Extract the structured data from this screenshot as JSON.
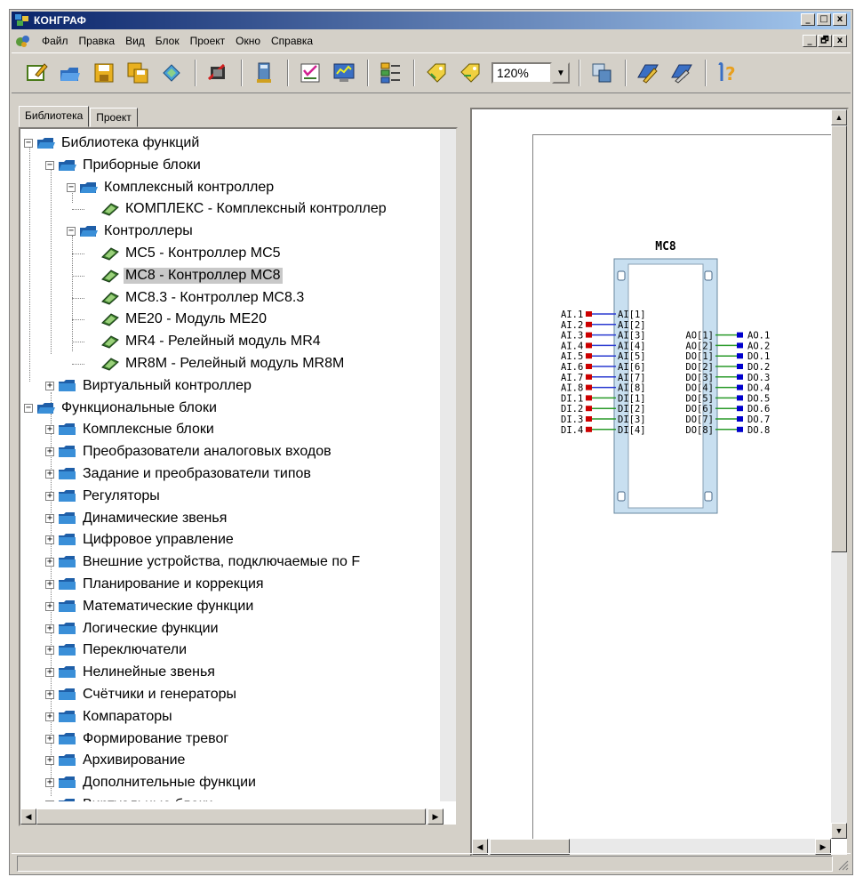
{
  "window": {
    "title": "КОНГРАФ"
  },
  "menu": [
    "Файл",
    "Правка",
    "Вид",
    "Блок",
    "Проект",
    "Окно",
    "Справка"
  ],
  "window_controls": [
    "_",
    "□",
    "x"
  ],
  "mdi_controls": [
    "_",
    "🗗",
    "x"
  ],
  "toolbar": {
    "zoom_value": "120%",
    "icons": [
      "new-icon",
      "open-icon",
      "save-icon",
      "save-all-icon",
      "refresh-icon",
      "compile-icon",
      "upload-icon",
      "checklist-icon",
      "monitor-icon",
      "block-list-icon",
      "tag-icon",
      "untag-icon",
      "copy-icon",
      "edit-icon",
      "pencil-icon",
      "help-icon"
    ]
  },
  "tabs": [
    "Библиотека",
    "Проект"
  ],
  "tree": [
    {
      "label": "Библиотека функций"
    },
    {
      "label": "Приборные блоки"
    },
    {
      "label": "Комплексный контроллер"
    },
    {
      "label": "КОМПЛЕКС - Комплексный контроллер"
    },
    {
      "label": "Контроллеры"
    },
    {
      "label": "MC5 - Контроллер MC5"
    },
    {
      "label": "MC8 - Контроллер MC8"
    },
    {
      "label": "MC8.3 - Контроллер MC8.3"
    },
    {
      "label": "ME20 - Модуль ME20"
    },
    {
      "label": "MR4 - Релейный модуль MR4"
    },
    {
      "label": "MR8M - Релейный модуль MR8M"
    },
    {
      "label": "Виртуальный контроллер"
    },
    {
      "label": "Функциональные блоки"
    },
    {
      "label": "Комплексные блоки"
    },
    {
      "label": "Преобразователи аналоговых входов"
    },
    {
      "label": "Задание и преобразователи типов"
    },
    {
      "label": "Регуляторы"
    },
    {
      "label": "Динамические звенья"
    },
    {
      "label": "Цифровое управление"
    },
    {
      "label": "Внешние устройства, подключаемые по F"
    },
    {
      "label": "Планирование и коррекция"
    },
    {
      "label": "Математические функции"
    },
    {
      "label": "Логические функции"
    },
    {
      "label": "Переключатели"
    },
    {
      "label": "Нелинейные звенья"
    },
    {
      "label": "Счётчики и генераторы"
    },
    {
      "label": "Компараторы"
    },
    {
      "label": "Формирование тревог"
    },
    {
      "label": "Архивирование"
    },
    {
      "label": "Дополнительные функции"
    },
    {
      "label": "Виртуальные блоки"
    }
  ],
  "block": {
    "name": "MC8",
    "inputs": [
      {
        "ext": "AI.1",
        "pin": "AI[1]"
      },
      {
        "ext": "AI.2",
        "pin": "AI[2]"
      },
      {
        "ext": "AI.3",
        "pin": "AI[3]"
      },
      {
        "ext": "AI.4",
        "pin": "AI[4]"
      },
      {
        "ext": "AI.5",
        "pin": "AI[5]"
      },
      {
        "ext": "AI.6",
        "pin": "AI[6]"
      },
      {
        "ext": "AI.7",
        "pin": "AI[7]"
      },
      {
        "ext": "AI.8",
        "pin": "AI[8]"
      },
      {
        "ext": "DI.1",
        "pin": "DI[1]"
      },
      {
        "ext": "DI.2",
        "pin": "DI[2]"
      },
      {
        "ext": "DI.3",
        "pin": "DI[3]"
      },
      {
        "ext": "DI.4",
        "pin": "DI[4]"
      }
    ],
    "outputs": [
      {
        "pin": "AO[1]",
        "ext": "AO.1"
      },
      {
        "pin": "AO[2]",
        "ext": "AO.2"
      },
      {
        "pin": "DO[1]",
        "ext": "DO.1"
      },
      {
        "pin": "DO[2]",
        "ext": "DO.2"
      },
      {
        "pin": "DO[3]",
        "ext": "DO.3"
      },
      {
        "pin": "DO[4]",
        "ext": "DO.4"
      },
      {
        "pin": "DO[5]",
        "ext": "DO.5"
      },
      {
        "pin": "DO[6]",
        "ext": "DO.6"
      },
      {
        "pin": "DO[7]",
        "ext": "DO.7"
      },
      {
        "pin": "DO[8]",
        "ext": "DO.8"
      }
    ]
  },
  "colors": {
    "title_from": "#0a246a",
    "title_to": "#a6caf0",
    "input_wire": "#cc0000",
    "output_wire": "#0000cc",
    "folder": "#3a8fd8",
    "selected": "#c8c8c8"
  }
}
